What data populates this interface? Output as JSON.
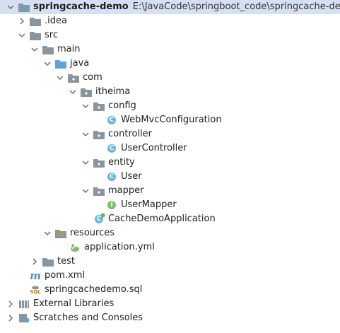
{
  "project": {
    "name": "springcache-demo",
    "path": "E:\\JavaCode\\springboot_code\\springcache-demo"
  },
  "tree": {
    "idea": ".idea",
    "src": "src",
    "main": "main",
    "java": "java",
    "com": "com",
    "itheima": "itheima",
    "config": "config",
    "web_mvc_configuration": "WebMvcConfiguration",
    "controller": "controller",
    "user_controller": "UserController",
    "entity": "entity",
    "user": "User",
    "mapper": "mapper",
    "user_mapper": "UserMapper",
    "cache_demo_application": "CacheDemoApplication",
    "resources": "resources",
    "application_yml": "application.yml",
    "test": "test",
    "pom_xml": "pom.xml",
    "sql_file": "springcachedemo.sql",
    "external_libraries": "External Libraries",
    "scratches": "Scratches and Consoles"
  },
  "icons": {
    "class_letter": "C",
    "interface_letter": "I",
    "sql_badge": "SQL",
    "maven_letter": "m"
  },
  "colors": {
    "folder": "#8b959e",
    "source_folder": "#5da3d9",
    "resource_folder": "#c8a24a",
    "class_badge": "#66b6dd",
    "interface_badge": "#7fbf6f",
    "selection": "#d5e1f2"
  }
}
